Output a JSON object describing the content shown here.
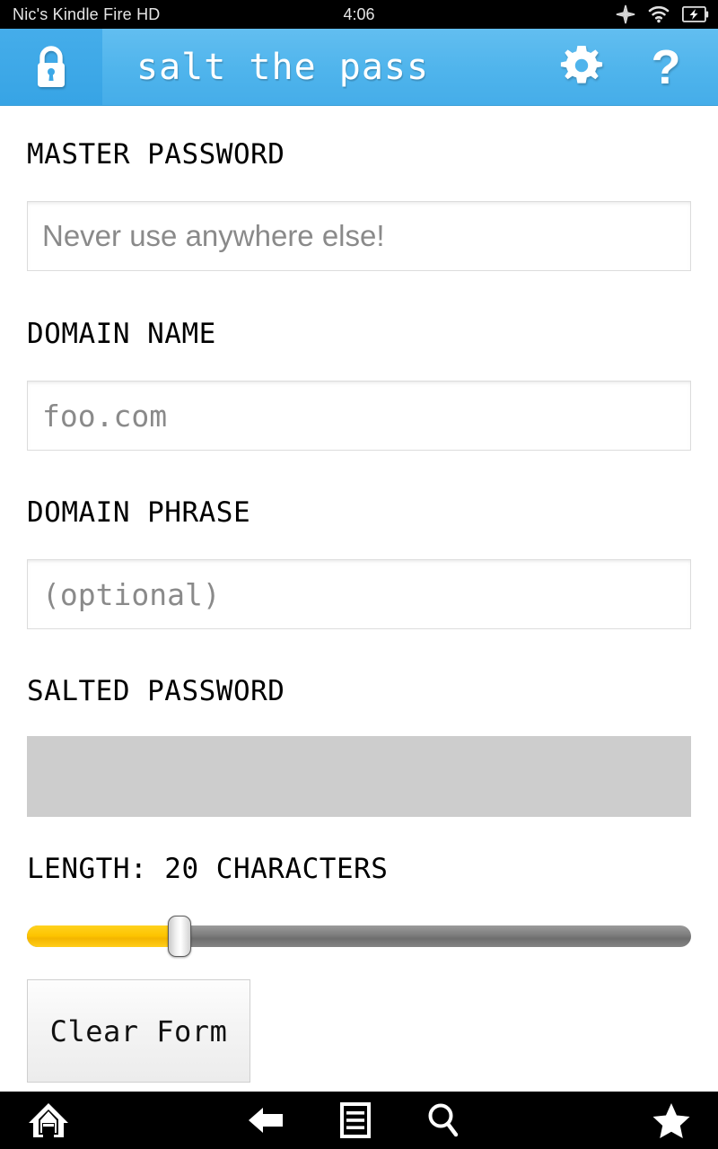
{
  "status_bar": {
    "device_name": "Nic's Kindle Fire HD",
    "time": "4:06",
    "icons": [
      "location-icon",
      "wifi-icon",
      "battery-charging-icon"
    ]
  },
  "app_bar": {
    "lock_icon": "lock-icon",
    "title": "salt the pass",
    "settings_icon": "gear-icon",
    "help_icon": "question-mark-icon",
    "background_color": "#4fb4ec",
    "lock_button_color": "#3ca8e7"
  },
  "form": {
    "master_password": {
      "label": "MASTER PASSWORD",
      "placeholder": "Never use anywhere else!",
      "value": ""
    },
    "domain_name": {
      "label": "DOMAIN NAME",
      "placeholder": "foo.com",
      "value": ""
    },
    "domain_phrase": {
      "label": "DOMAIN PHRASE",
      "placeholder": "(optional)",
      "value": ""
    },
    "salted_password": {
      "label": "SALTED PASSWORD",
      "value": "",
      "background_color": "#cdcdcd"
    },
    "length": {
      "label": "LENGTH: 20 CHARACTERS",
      "value": 20,
      "min": 4,
      "max": 74,
      "fill_percent": 23,
      "fill_color": "#fdc400",
      "track_color": "#7d7d7d"
    },
    "clear_button": {
      "label": "Clear Form"
    }
  },
  "nav_bar": {
    "home_icon": "home-icon",
    "back_icon": "back-arrow-icon",
    "menu_icon": "menu-icon",
    "search_icon": "search-icon",
    "favorite_icon": "star-icon",
    "background_color": "#000000"
  }
}
